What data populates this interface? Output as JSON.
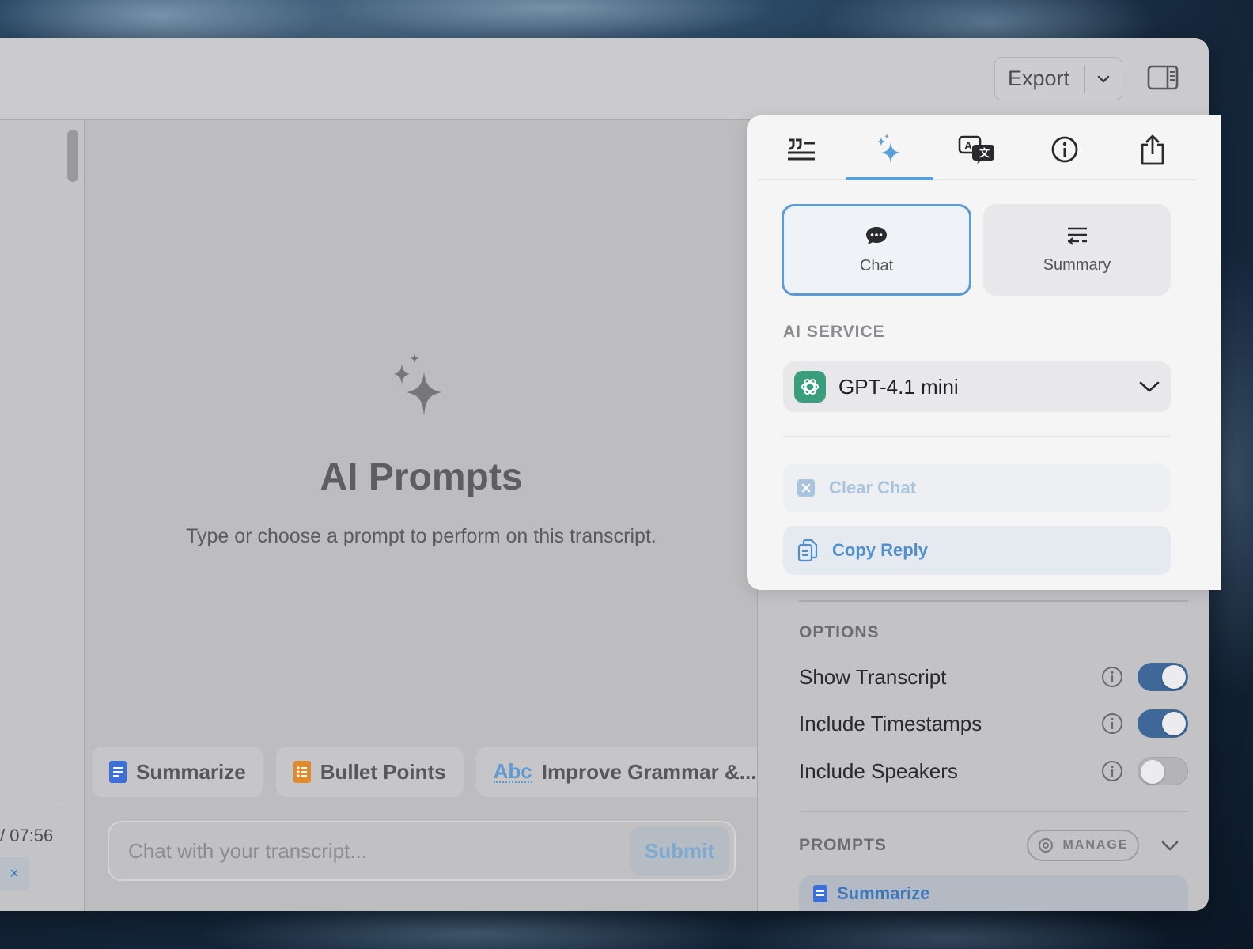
{
  "toolbar": {
    "export_label": "Export"
  },
  "left": {
    "time_readout": "/ 07:56",
    "close_glyph": "×"
  },
  "main": {
    "title": "AI Prompts",
    "subtitle": "Type or choose a prompt to perform on this transcript.",
    "chips": [
      {
        "label": "Summarize",
        "icon": "blue-doc-icon",
        "color": "#3d6fd8"
      },
      {
        "label": "Bullet Points",
        "icon": "orange-list-icon",
        "color": "#e08a2e"
      },
      {
        "label": "Improve Grammar &...",
        "icon_text": "Abc"
      }
    ],
    "chat_placeholder": "Chat with your transcript...",
    "submit_label": "Submit"
  },
  "panel": {
    "tabs": [
      {
        "icon": "transcript-quote-icon"
      },
      {
        "icon": "sparkle-icon",
        "active": true
      },
      {
        "icon": "translate-icon"
      },
      {
        "icon": "info-icon"
      },
      {
        "icon": "share-icon"
      }
    ],
    "modes": [
      {
        "label": "Chat",
        "icon": "chat-bubble-icon",
        "selected": true
      },
      {
        "label": "Summary",
        "icon": "summary-lines-icon",
        "selected": false
      }
    ],
    "ai_service_label": "AI SERVICE",
    "ai_service_value": "GPT-4.1 mini",
    "clear_chat_label": "Clear Chat",
    "copy_reply_label": "Copy Reply",
    "options_label": "OPTIONS",
    "options": [
      {
        "label": "Show Transcript",
        "on": true
      },
      {
        "label": "Include Timestamps",
        "on": true
      },
      {
        "label": "Include Speakers",
        "on": false
      }
    ],
    "prompts_label": "PROMPTS",
    "manage_label": "MANAGE",
    "first_prompt": "Summarize"
  },
  "colors": {
    "accent": "#5a9fd8",
    "toggle_on": "#3d6897",
    "openai_green": "#3a9e7c"
  }
}
